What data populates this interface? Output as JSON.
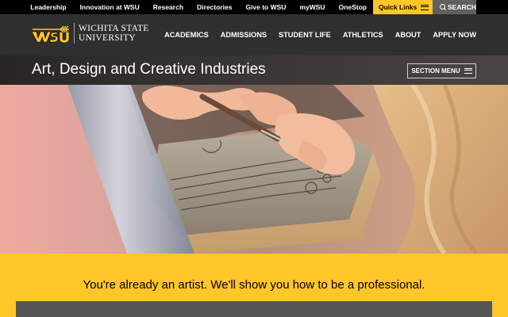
{
  "utility": {
    "links": [
      "Leadership",
      "Innovation at WSU",
      "Research",
      "Directories",
      "Give to WSU",
      "myWSU",
      "OneStop"
    ],
    "quick_links": "Quick Links",
    "search": "SEARCH"
  },
  "brand": {
    "line1": "Wichita State",
    "line2": "University",
    "accent_color": "#ffc629"
  },
  "nav": {
    "items": [
      "ACADEMICS",
      "ADMISSIONS",
      "STUDENT LIFE",
      "ATHLETICS",
      "ABOUT",
      "APPLY NOW"
    ]
  },
  "section": {
    "title": "Art, Design and Creative Industries",
    "menu_label": "SECTION MENU"
  },
  "callout": {
    "text": "You're already an artist. We'll show you how to be a professional."
  }
}
